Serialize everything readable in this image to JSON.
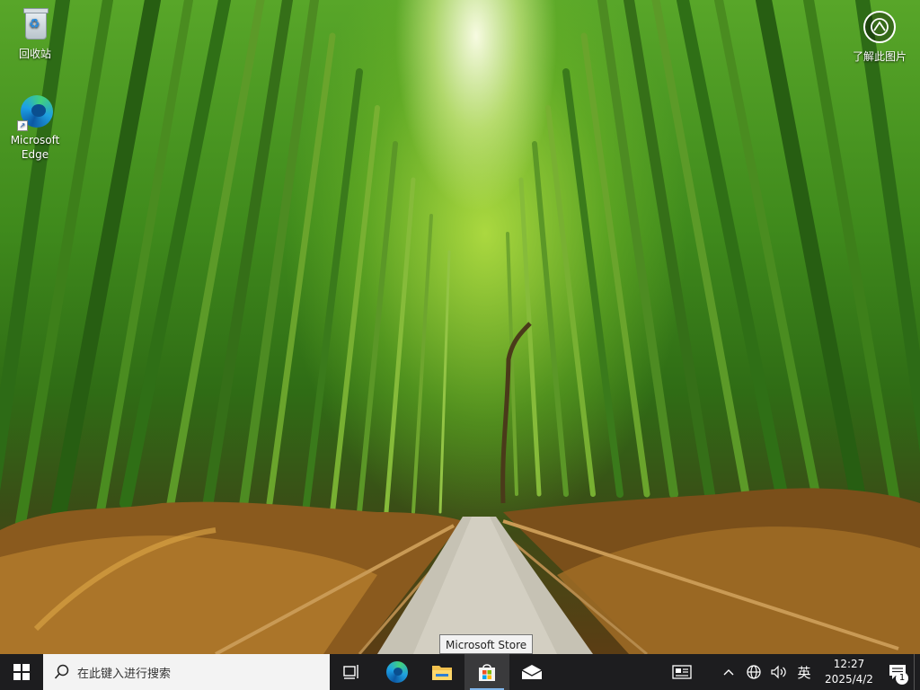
{
  "desktop": {
    "icons": [
      {
        "label": "回收站",
        "icon": "recycle-bin-icon"
      },
      {
        "label": "Microsoft\nEdge",
        "label_line1": "Microsoft",
        "label_line2": "Edge",
        "icon": "edge-icon"
      }
    ],
    "about_picture": {
      "label": "了解此图片",
      "icon": "camera-circle-icon"
    }
  },
  "tooltip": {
    "text": "Microsoft Store"
  },
  "taskbar": {
    "start_icon": "windows-start-icon",
    "search": {
      "placeholder": "在此键入进行搜索",
      "icon": "search-icon"
    },
    "pinned": [
      {
        "name": "Task View",
        "icon": "task-view-icon"
      },
      {
        "name": "Microsoft Edge",
        "icon": "edge-icon"
      },
      {
        "name": "File Explorer",
        "icon": "folder-icon"
      },
      {
        "name": "Microsoft Store",
        "icon": "store-icon",
        "active": true
      },
      {
        "name": "Mail",
        "icon": "mail-icon"
      }
    ],
    "tray": {
      "ime_mode": "英",
      "time": "12:27",
      "date": "2025/4/2",
      "notification_count": "1"
    }
  },
  "colors": {
    "taskbar_bg": "#1d1d1f",
    "search_bg": "#f3f3f3",
    "accent": "#7fb4e8"
  }
}
